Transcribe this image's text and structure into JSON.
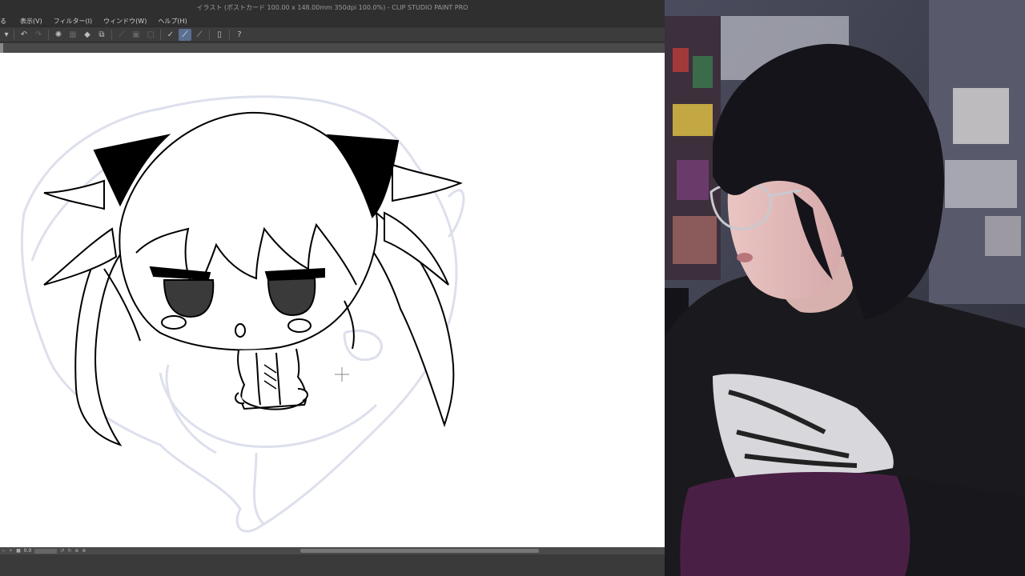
{
  "app": {
    "title": "イラスト (ポストカード 100.00 x 148.00mm 350dpi 100.0%)  - CLIP STUDIO PAINT PRO",
    "menu": [
      "る",
      "表示(V)",
      "フィルター(I)",
      "ウィンドウ(W)",
      "ヘルプ(H)"
    ],
    "toolbar_icons": [
      "menu-dropdown-icon",
      "undo-icon",
      "redo-icon",
      "clear-icon",
      "fill-icon",
      "transform-icon",
      "select-all-icon",
      "deselect-icon",
      "crop-icon",
      "ruler-icon",
      "snap-to-special-ruler-icon",
      "snap-to-grid-icon",
      "lasso-icon",
      "tablet-icon",
      "help-icon"
    ],
    "status": {
      "zoom": "0.0"
    }
  },
  "colors": {
    "app_bg": "#3a3a3a",
    "titlebar_bg": "#2f2f2f",
    "active_tool": "#5b6f91",
    "canvas": "#ffffff",
    "sketch_line": "#dde0ec",
    "ink": "#000000"
  }
}
